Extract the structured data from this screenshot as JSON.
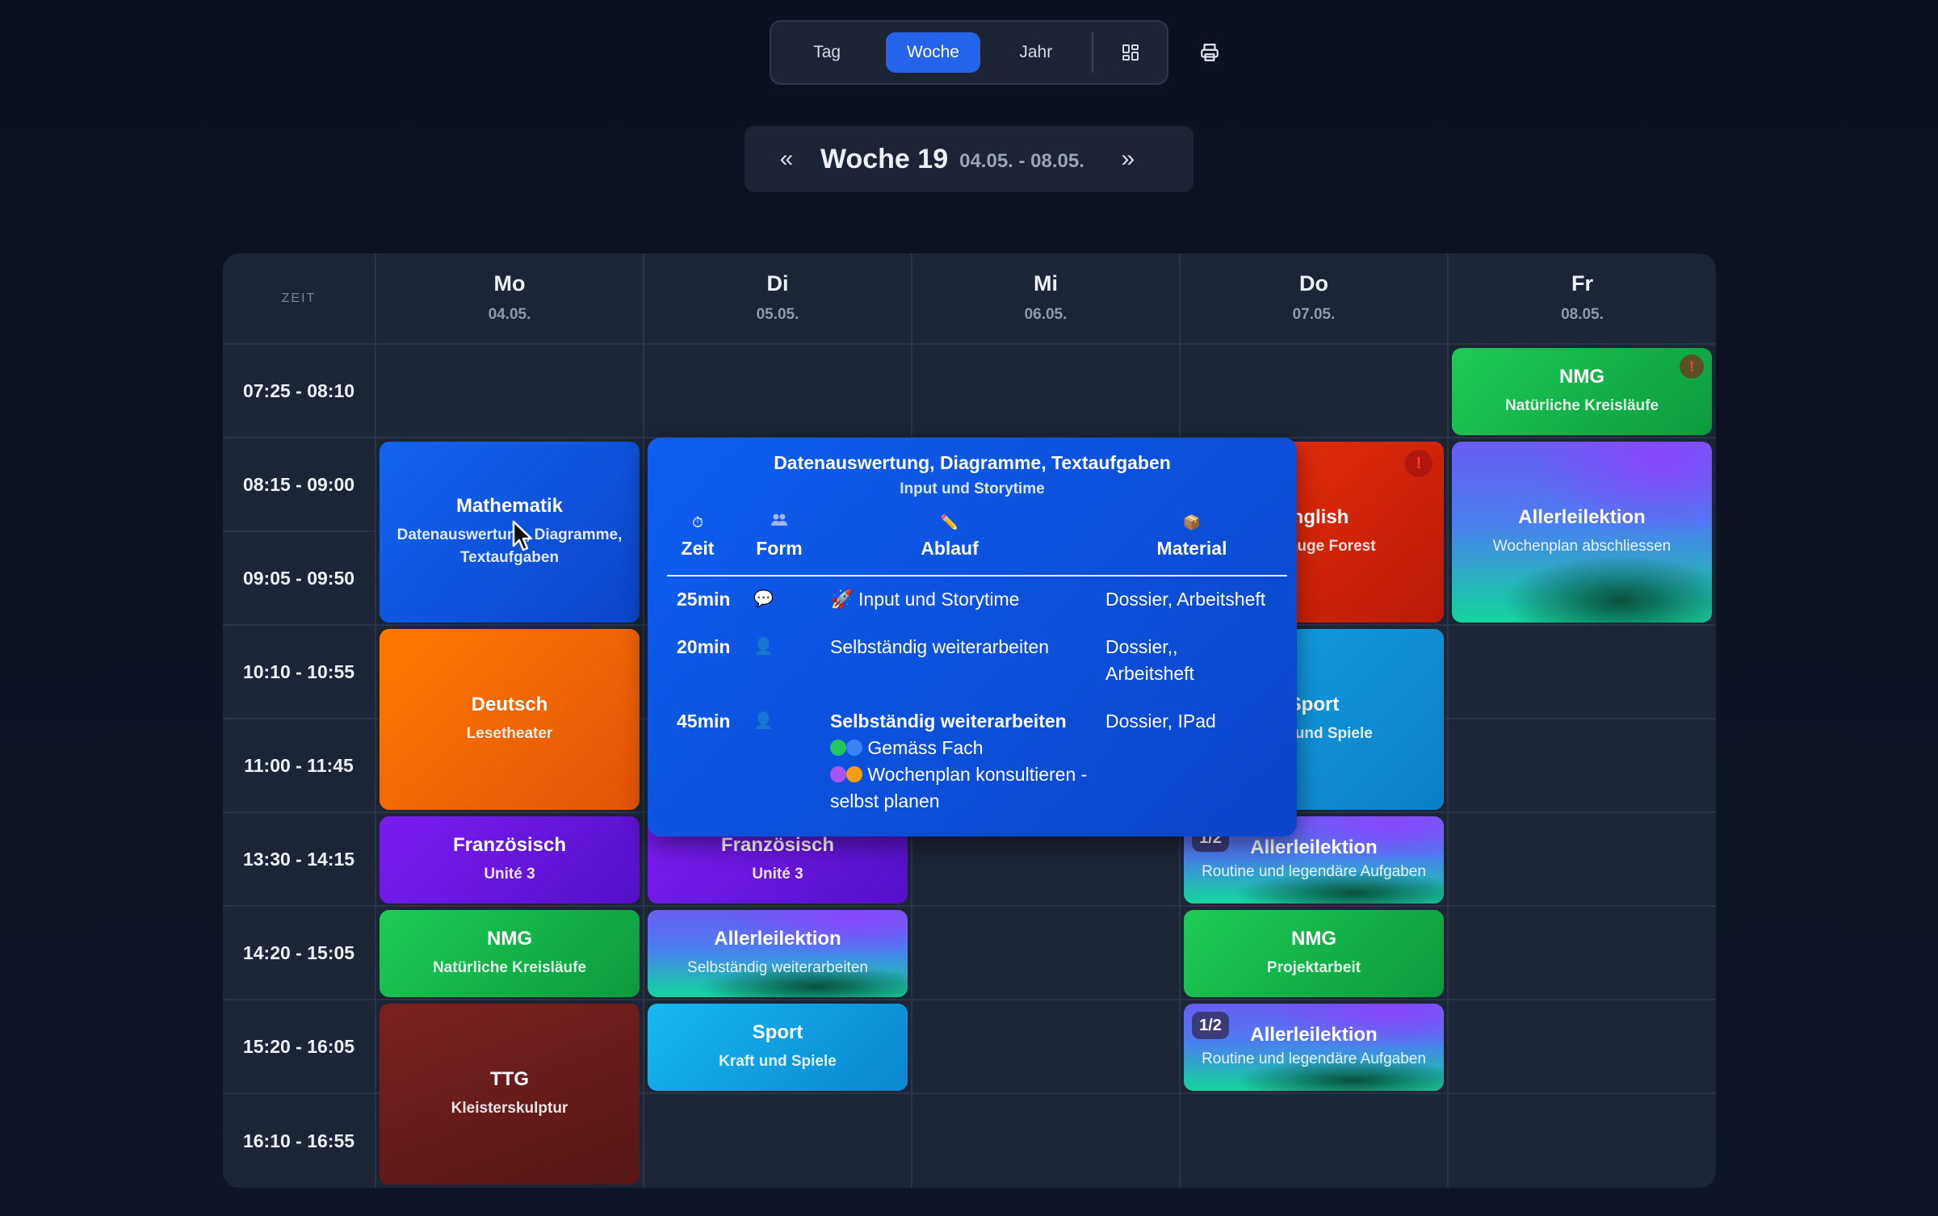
{
  "view_switcher": {
    "tag": "Tag",
    "woche": "Woche",
    "jahr": "Jahr",
    "active": "Woche",
    "accent": "#2563eb"
  },
  "week_nav": {
    "prev": "«",
    "title": "Woche 19",
    "range": "04.05. - 08.05.",
    "next": "»"
  },
  "timetable": {
    "zeit_label": "ZEIT",
    "days": [
      {
        "name": "Mo",
        "date": "04.05."
      },
      {
        "name": "Di",
        "date": "05.05."
      },
      {
        "name": "Mi",
        "date": "06.05."
      },
      {
        "name": "Do",
        "date": "07.05."
      },
      {
        "name": "Fr",
        "date": "08.05."
      }
    ],
    "times": [
      "07:25 - 08:10",
      "08:15 - 09:00",
      "09:05 - 09:50",
      "10:10 - 10:55",
      "11:00 - 11:45",
      "13:30 - 14:15",
      "14:20 - 15:05",
      "15:20 - 16:05",
      "16:10 - 16:55"
    ],
    "lessons": {
      "mo_mathe": {
        "title": "Mathematik",
        "sub": "Datenauswertung, Diagramme, Textaufgaben"
      },
      "mo_deutsch": {
        "title": "Deutsch",
        "sub": "Lesetheater"
      },
      "mo_franz": {
        "title": "Französisch",
        "sub": "Unité 3"
      },
      "mo_nmg": {
        "title": "NMG",
        "sub": "Natürliche Kreisläufe"
      },
      "mo_ttg": {
        "title": "TTG",
        "sub": "Kleisterskulptur"
      },
      "di_franz": {
        "title": "Französisch",
        "sub": "Unité 3"
      },
      "di_aller": {
        "title": "Allerleilektion",
        "sub": "Selbständig weiterarbeiten"
      },
      "di_sport": {
        "title": "Sport",
        "sub": "Kraft und Spiele"
      },
      "do_english": {
        "title": "English",
        "sub": "Langauge Forest",
        "badge": "!"
      },
      "do_sport": {
        "title": "Sport",
        "sub": "Kraft und Spiele"
      },
      "do_aller1": {
        "title": "Allerleilektion",
        "sub": "Routine und legendäre Aufgaben",
        "badge": "1/2"
      },
      "do_nmg": {
        "title": "NMG",
        "sub": "Projektarbeit"
      },
      "do_aller2": {
        "title": "Allerleilektion",
        "sub": "Routine und legendäre Aufgaben",
        "badge": "1/2"
      },
      "fr_nmg": {
        "title": "NMG",
        "sub": "Natürliche Kreisläufe",
        "badge": "!"
      },
      "fr_aller": {
        "title": "Allerleilektion",
        "sub": "Wochenplan abschliessen"
      }
    }
  },
  "popover": {
    "title": "Datenauswertung, Diagramme, Textaufgaben",
    "subtitle": "Input und Storytime",
    "columns": {
      "zeit": "Zeit",
      "form": "Form",
      "ablauf": "Ablauf",
      "material": "Material"
    },
    "column_icons": {
      "zeit": "stopwatch-icon",
      "form": "people-icon",
      "ablauf": "pencil-icon",
      "material": "package-icon"
    },
    "rows": [
      {
        "zeit": "25min",
        "form_icon": "speech-bubble-icon",
        "ablauf": "🚀 Input und Storytime",
        "material": "Dossier, Arbeitsheft"
      },
      {
        "zeit": "20min",
        "form_icon": "person-icon",
        "ablauf": "Selbständig weiterarbeiten",
        "material": "Dossier,, Arbeitsheft"
      },
      {
        "zeit": "45min",
        "form_icon": "person-icon",
        "ablauf": "Selbständig weiterarbeiten",
        "ablauf_line2": "Gemäss Fach",
        "ablauf_line3": "Wochenplan konsultieren - selbst planen",
        "material": "Dossier, IPad"
      }
    ]
  }
}
